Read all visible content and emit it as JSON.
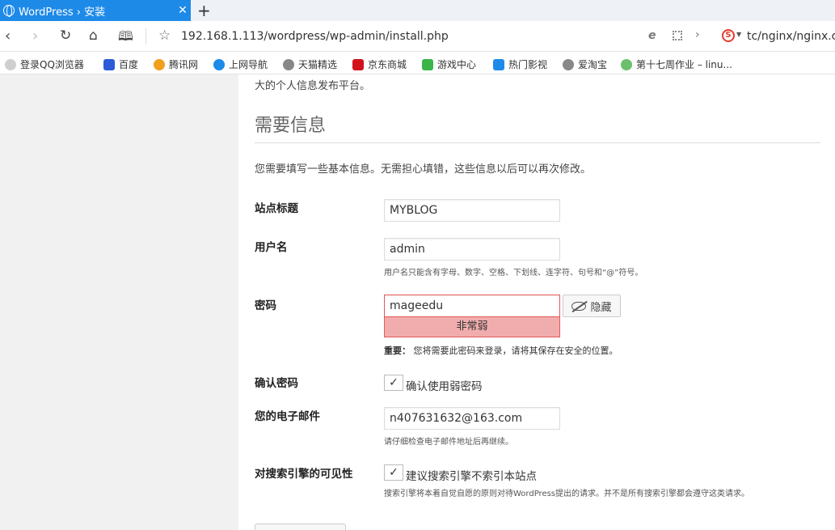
{
  "browser": {
    "tab_title": "WordPress › 安装",
    "tab_close": "✕",
    "new_tab": "+",
    "url": "192.168.1.113/wordpress/wp-admin/install.php",
    "search_text": "tc/nginx/nginx.co",
    "bookmarks": [
      {
        "label": "登录QQ浏览器",
        "color": "#cfcfcf"
      },
      {
        "label": "百度",
        "color": "#2b5bd7"
      },
      {
        "label": "腾讯网",
        "color": "#f0a01c"
      },
      {
        "label": "上网导航",
        "color": "#1e8ae8"
      },
      {
        "label": "天猫精选",
        "color": "#888888"
      },
      {
        "label": "京东商城",
        "color": "#d1121b"
      },
      {
        "label": "游戏中心",
        "color": "#3ab54a"
      },
      {
        "label": "热门影视",
        "color": "#1e8ae8"
      },
      {
        "label": "爱淘宝",
        "color": "#888888"
      },
      {
        "label": "第十七周作业 – linu...",
        "color": "#6cc06c"
      }
    ]
  },
  "page": {
    "intro_tail": "大的个人信息发布平台。",
    "heading": "需要信息",
    "description": "您需要填写一些基本信息。无需担心填错，这些信息以后可以再次修改。",
    "site_title": {
      "label": "站点标题",
      "value": "MYBLOG"
    },
    "username": {
      "label": "用户名",
      "value": "admin",
      "hint": "用户名只能含有字母、数字、空格、下划线、连字符、句号和“@”符号。"
    },
    "password": {
      "label": "密码",
      "value": "mageedu",
      "strength": "非常弱",
      "hide_button": "隐藏",
      "important_label": "重要：",
      "important_text": "您将需要此密码来登录，请将其保存在安全的位置。"
    },
    "confirm_password": {
      "label": "确认密码",
      "checkbox_label": "确认使用弱密码",
      "checked": "✓"
    },
    "email": {
      "label": "您的电子邮件",
      "value": "n407631632@163.com",
      "hint": "请仔细检查电子邮件地址后再继续。"
    },
    "search_visibility": {
      "label": "对搜索引擎的可见性",
      "checkbox_label": "建议搜索引擎不索引本站点",
      "checked": "✓",
      "hint": "搜索引擎将本着自觉自愿的原则对待WordPress提出的请求。并不是所有搜索引擎都会遵守这类请求。"
    }
  }
}
